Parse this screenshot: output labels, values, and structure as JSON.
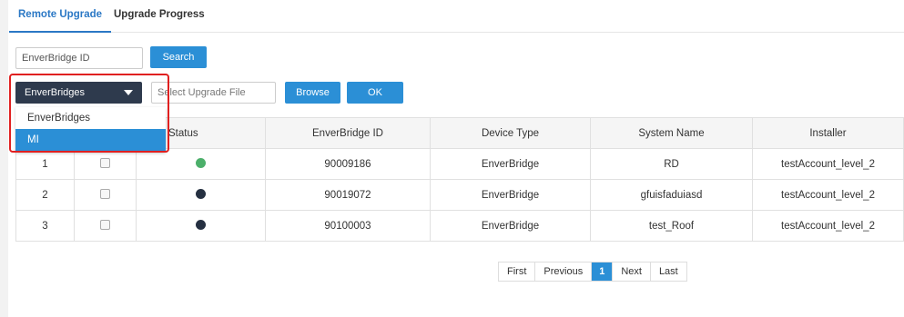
{
  "tabs": [
    {
      "label": "Remote Upgrade",
      "active": true
    },
    {
      "label": "Upgrade Progress",
      "active": false
    }
  ],
  "search": {
    "placeholder": "EnverBridge ID",
    "button_label": "Search"
  },
  "device_select": {
    "value": "EnverBridges",
    "options": [
      "EnverBridges",
      "MI"
    ],
    "highlighted": "MI"
  },
  "upgrade": {
    "file_placeholder": "Select Upgrade File",
    "browse_label": "Browse",
    "ok_label": "OK"
  },
  "table": {
    "headers": [
      "",
      "",
      "Status",
      "EnverBridge ID",
      "Device Type",
      "System Name",
      "Installer"
    ],
    "rows": [
      {
        "no": "1",
        "status_color": "#4caf6a",
        "id": "90009186",
        "type": "EnverBridge",
        "system": "RD",
        "installer": "testAccount_level_2"
      },
      {
        "no": "2",
        "status_color": "#253041",
        "id": "90019072",
        "type": "EnverBridge",
        "system": "gfuisfaduiasd",
        "installer": "testAccount_level_2"
      },
      {
        "no": "3",
        "status_color": "#253041",
        "id": "90100003",
        "type": "EnverBridge",
        "system": "test_Roof",
        "installer": "testAccount_level_2"
      }
    ]
  },
  "pagination": {
    "first": "First",
    "previous": "Previous",
    "current": "1",
    "next": "Next",
    "last": "Last"
  },
  "colors": {
    "accent": "#2b8fd6",
    "select_bg": "#2e3a4d",
    "highlight_border": "#e02020"
  }
}
